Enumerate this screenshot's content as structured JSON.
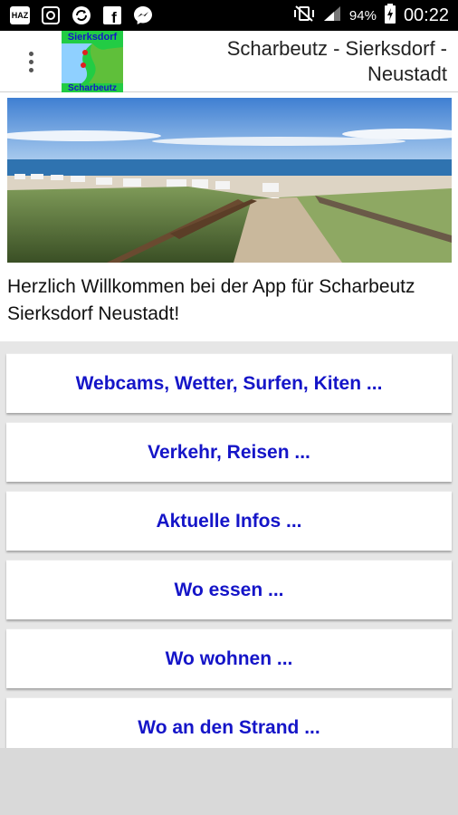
{
  "status_bar": {
    "left_icons": [
      "haz-app-icon",
      "security-app-icon",
      "sync-icon",
      "facebook-icon",
      "messenger-icon"
    ],
    "haz_label": "HAZ",
    "facebook_label": "f",
    "battery_percent": "94%",
    "time": "00:22"
  },
  "action_bar": {
    "logo_top": "Sierksdorf",
    "logo_bottom": "Scharbeutz",
    "title": "Scharbeutz - Sierksdorf - Neustadt"
  },
  "main": {
    "welcome_text": "Herzlich Willkommen bei der App für Scharbeutz Sierksdorf Neustadt!",
    "buttons": [
      "Webcams, Wetter, Surfen, Kiten ...",
      "Verkehr, Reisen ...",
      "Aktuelle Infos ...",
      "Wo essen ...",
      "Wo wohnen ...",
      "Wo an den Strand ..."
    ]
  },
  "colors": {
    "button_text": "#1515c8",
    "status_bar_bg": "#000000",
    "logo_bg": "#22cc44"
  }
}
